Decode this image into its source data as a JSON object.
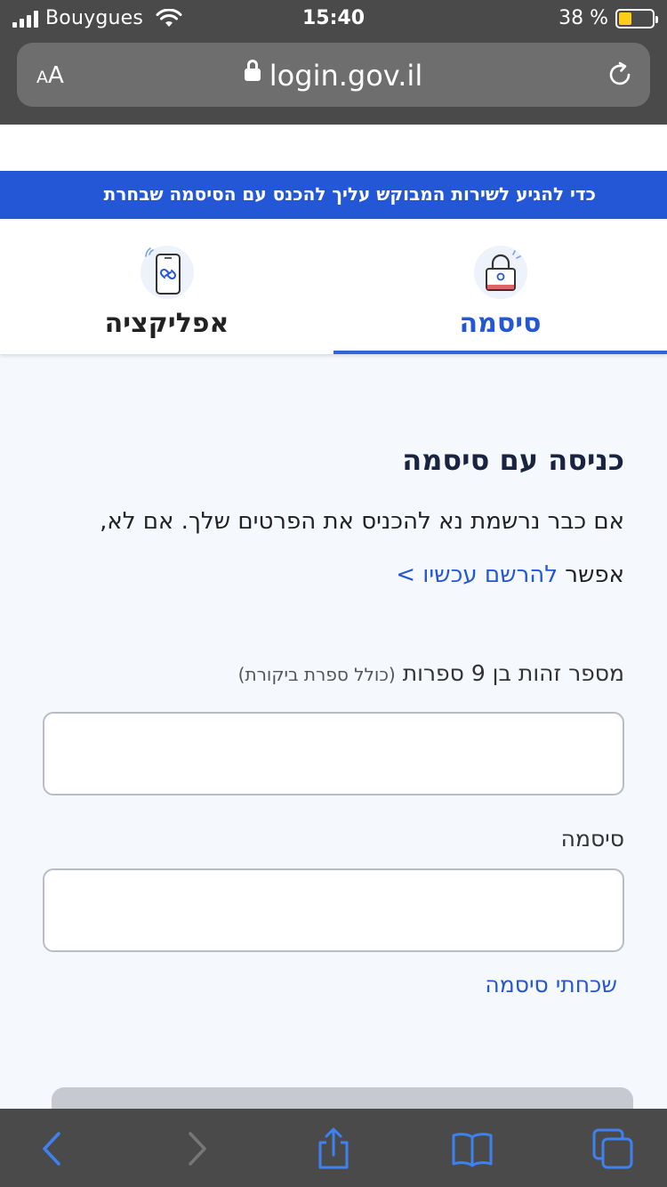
{
  "status_bar": {
    "carrier": "Bouygues",
    "time": "15:40",
    "battery_percent": "38 %",
    "battery_level": 0.38
  },
  "address_bar": {
    "text_size_label": "AA",
    "url": "login.gov.il"
  },
  "banner": {
    "text": "כדי להגיע לשירות המבוקש עליך להכנס עם הסיסמה שבחרת"
  },
  "tabs": [
    {
      "label": "סיסמה",
      "icon": "lock-icon",
      "selected": true
    },
    {
      "label": "אפליקציה",
      "icon": "phone-link-icon",
      "selected": false
    }
  ],
  "login": {
    "title": "כניסה עם סיסמה",
    "intro_text": "אם כבר נרשמת נא להכניס את הפרטים שלך. אם לא, אפשר",
    "register_link": "להרשם עכשיו >",
    "id_label": "מספר זהות בן 9 ספרות",
    "id_hint": "(כולל ספרת ביקורת)",
    "id_value": "",
    "password_label": "סיסמה",
    "password_value": "",
    "forgot_password": "שכחתי סיסמה"
  },
  "colors": {
    "accent": "#2457d6",
    "chrome": "#4a4a4a",
    "page_background": "#f5f8fd",
    "battery": "#ffcd1a"
  }
}
